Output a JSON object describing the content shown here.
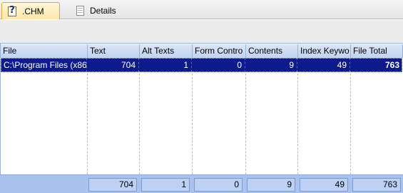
{
  "tabs": [
    {
      "label": ".CHM",
      "icon": "chm-help-file-icon",
      "active": true
    },
    {
      "label": "Details",
      "icon": "document-icon",
      "active": false
    }
  ],
  "grid": {
    "columns": [
      "File",
      "Text",
      "Alt Texts",
      "Form Contro",
      "Contents",
      "Index Keywo",
      "File Total"
    ],
    "rows": [
      {
        "file": "C:\\Program Files (x86",
        "text": "704",
        "alt_texts": "1",
        "form_controls": "0",
        "contents": "9",
        "index_keywords": "49",
        "file_total": "763"
      }
    ],
    "selected_row_color": "#0c1a8c"
  },
  "footer": {
    "totals": {
      "text": "704",
      "alt_texts": "1",
      "form_controls": "0",
      "contents": "9",
      "index_keywords": "49",
      "file_total": "763"
    }
  }
}
